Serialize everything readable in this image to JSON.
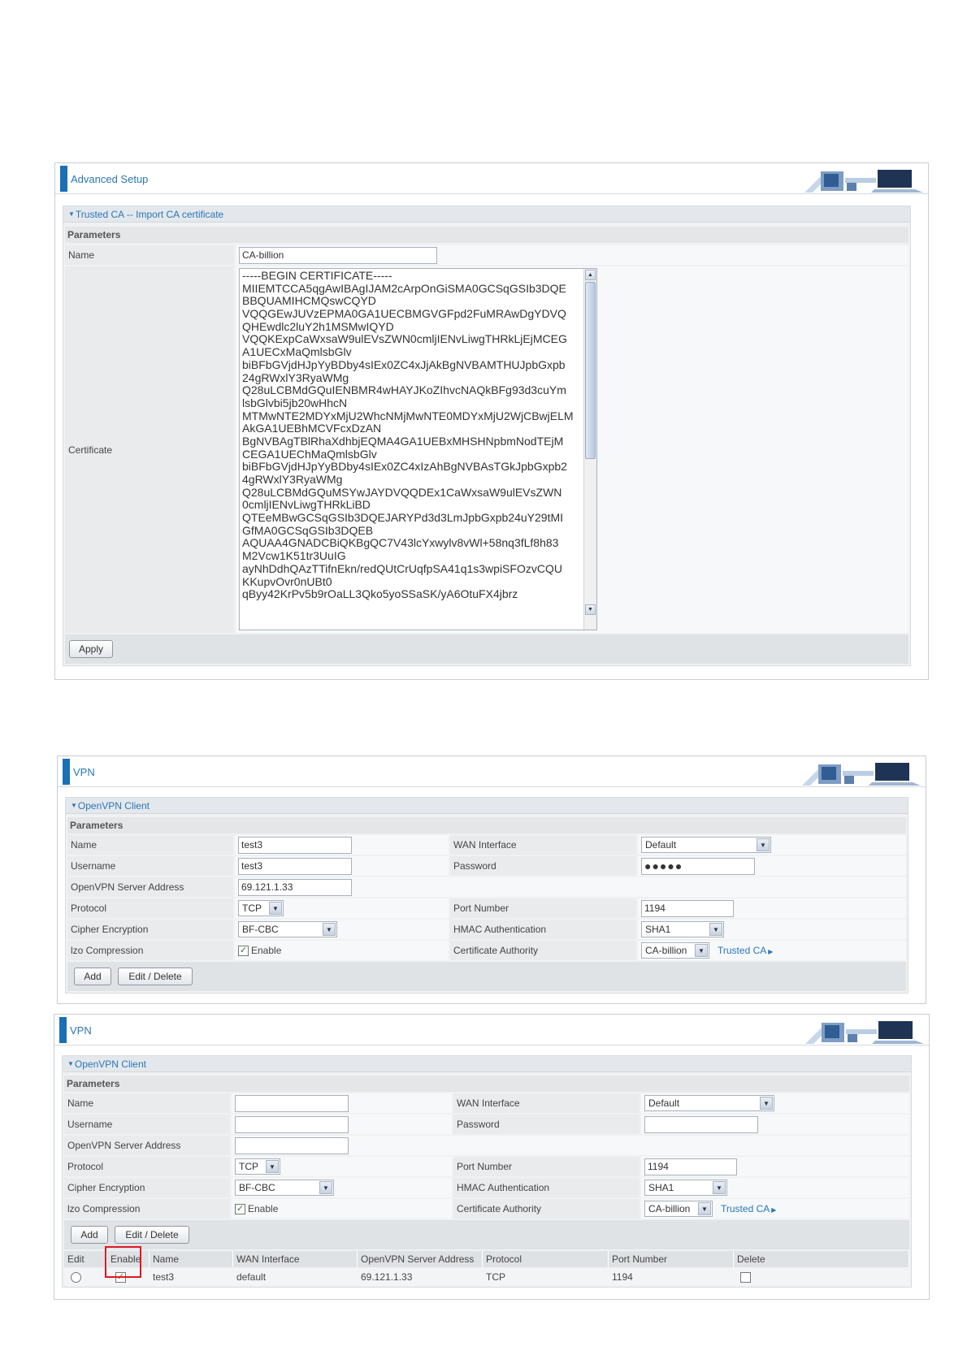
{
  "colors": {
    "accent": "#2a76b8",
    "header_bar": "#1a6fb5",
    "highlight": "#e0171f"
  },
  "panel1": {
    "header_title": "Advanced Setup",
    "section_title": "Trusted CA -- Import CA certificate",
    "parameters_label": "Parameters",
    "name_label": "Name",
    "name_value": "CA-billion",
    "certificate_label": "Certificate",
    "certificate_lines": [
      "-----BEGIN CERTIFICATE-----",
      "MIIEMTCCA5qgAwIBAgIJAM2cArpOnGiSMA0GCSqGSIb3DQE",
      "BBQUAMIHCMQswCQYD",
      "VQQGEwJUVzEPMA0GA1UECBMGVGFpd2FuMRAwDgYDVQ",
      "QHEwdlc2luY2h1MSMwIQYD",
      "VQQKExpCaWxsaW9ulEVsZWN0cmljIENvLiwgTHRkLjEjMCEG",
      "A1UECxMaQmlsbGlv",
      "biBFbGVjdHJpYyBDby4sIEx0ZC4xJjAkBgNVBAMTHUJpbGxpb",
      "24gRWxlY3RyaWMg",
      "Q28uLCBMdGQuIENBMR4wHAYJKoZIhvcNAQkBFg93d3cuYm",
      "lsbGlvbi5jb20wHhcN",
      "MTMwNTE2MDYxMjU2WhcNMjMwNTE0MDYxMjU2WjCBwjELM",
      "AkGA1UEBhMCVFcxDzAN",
      "BgNVBAgTBlRhaXdhbjEQMA4GA1UEBxMHSHNpbmNodTEjM",
      "CEGA1UEChMaQmlsbGlv",
      "biBFbGVjdHJpYyBDby4sIEx0ZC4xIzAhBgNVBAsTGkJpbGxpb2",
      "4gRWxlY3RyaWMg",
      "Q28uLCBMdGQuMSYwJAYDVQQDEx1CaWxsaW9ulEVsZWN",
      "0cmljIENvLiwgTHRkLiBD",
      "QTEeMBwGCSqGSIb3DQEJARYPd3d3LmJpbGxpb24uY29tMI",
      "GfMA0GCSqGSIb3DQEB",
      "AQUAA4GNADCBiQKBgQC7V43lcYxwylv8vWl+58nq3fLf8h83",
      "M2Vcw1K51tr3UuIG",
      "ayNhDdhQAzTTifnEkn/redQUtCrUqfpSA41q1s3wpiSFOzvCQU",
      "KKupvOvr0nUBt0",
      "qByy42KrPv5b9rOaLL3Qko5yoSSaSK/yA6OtuFX4jbrz"
    ],
    "apply_label": "Apply"
  },
  "panel2": {
    "header_title": "VPN",
    "section_title": "OpenVPN Client",
    "parameters_label": "Parameters",
    "labels": {
      "name": "Name",
      "username": "Username",
      "server": "OpenVPN Server Address",
      "protocol": "Protocol",
      "cipher": "Cipher Encryption",
      "lzo": "lzo Compression",
      "wan": "WAN Interface",
      "password": "Password",
      "port": "Port Number",
      "hmac": "HMAC Authentication",
      "ca": "Certificate Authority"
    },
    "values": {
      "name": "test3",
      "username": "test3",
      "server": "69.121.1.33",
      "protocol": "TCP",
      "cipher": "BF-CBC",
      "lzo_enable": "Enable",
      "wan": "Default",
      "password": "●●●●●",
      "port": "1194",
      "hmac": "SHA1",
      "ca": "CA-billion"
    },
    "trusted_ca_link": "Trusted CA",
    "add_label": "Add",
    "edit_delete_label": "Edit / Delete"
  },
  "panel3": {
    "header_title": "VPN",
    "section_title": "OpenVPN Client",
    "parameters_label": "Parameters",
    "labels": {
      "name": "Name",
      "username": "Username",
      "server": "OpenVPN Server Address",
      "protocol": "Protocol",
      "cipher": "Cipher Encryption",
      "lzo": "lzo Compression",
      "wan": "WAN Interface",
      "password": "Password",
      "port": "Port Number",
      "hmac": "HMAC Authentication",
      "ca": "Certificate Authority"
    },
    "values": {
      "name": "",
      "username": "",
      "server": "",
      "protocol": "TCP",
      "cipher": "BF-CBC",
      "lzo_enable": "Enable",
      "wan": "Default",
      "password": "",
      "port": "1194",
      "hmac": "SHA1",
      "ca": "CA-billion"
    },
    "trusted_ca_link": "Trusted CA",
    "add_label": "Add",
    "edit_delete_label": "Edit / Delete",
    "table": {
      "headers": [
        "Edit",
        "Enable",
        "Name",
        "WAN Interface",
        "OpenVPN Server Address",
        "Protocol",
        "Port Number",
        "Delete"
      ],
      "row": {
        "name": "test3",
        "wan": "default",
        "server": "69.121.1.33",
        "protocol": "TCP",
        "port": "1194"
      }
    }
  }
}
